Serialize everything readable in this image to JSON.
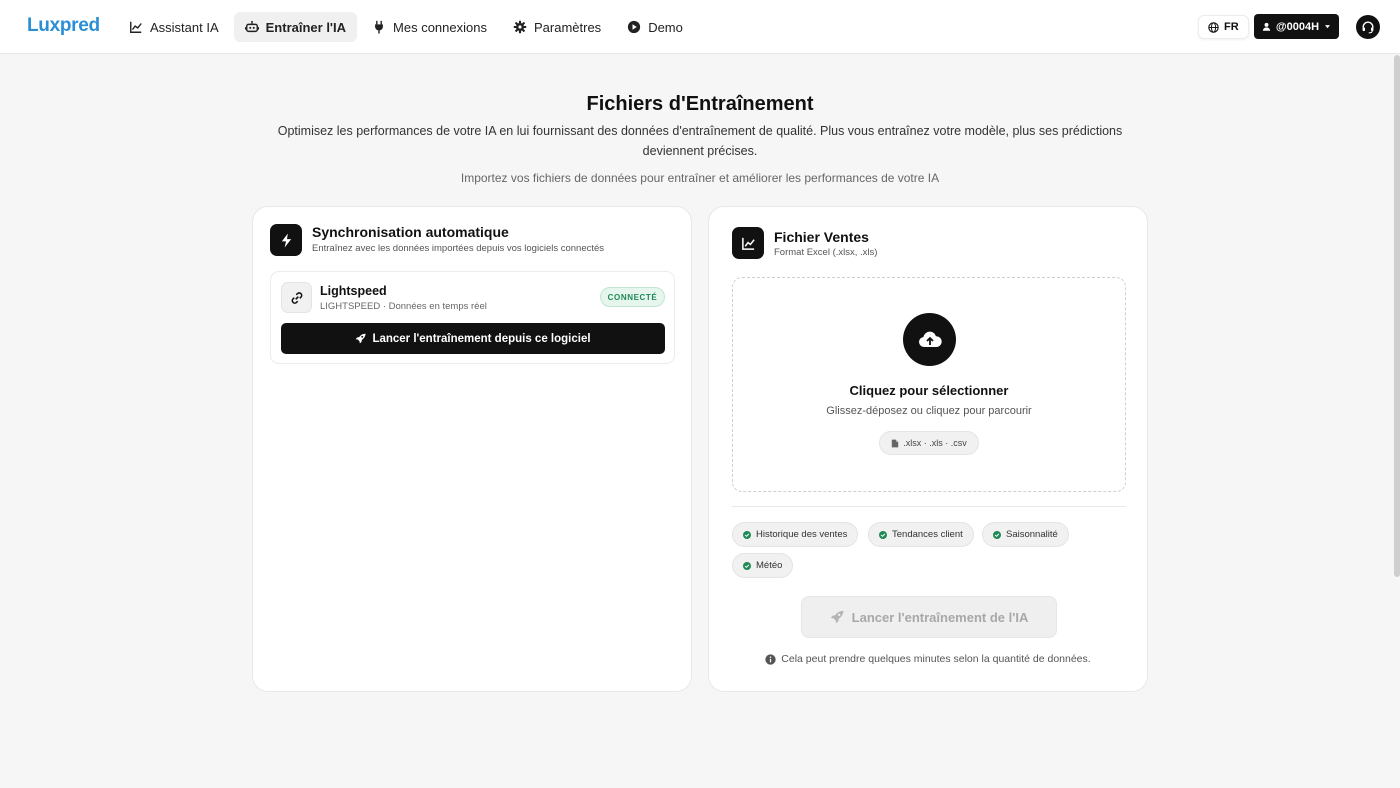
{
  "nav": {
    "logo": "Luxpred",
    "links": [
      {
        "label": "Assistant IA",
        "icon": "chart-line-icon",
        "active": false
      },
      {
        "label": "Entraîner l'IA",
        "icon": "robot-icon",
        "active": true
      },
      {
        "label": "Mes connexions",
        "icon": "plug-icon",
        "active": false
      },
      {
        "label": "Paramètres",
        "icon": "gear-icon",
        "active": false
      },
      {
        "label": "Demo",
        "icon": "play-circle-icon",
        "active": false
      }
    ],
    "lang": "FR",
    "user": "@0004H"
  },
  "header": {
    "title": "Fichiers d'Entraînement",
    "description": "Optimisez les performances de votre IA en lui fournissant des données d'entraînement de qualité. Plus vous entraînez votre modèle, plus ses prédictions deviennent précises.",
    "subtitle": "Importez vos fichiers de données pour entraîner et améliorer les performances de votre IA"
  },
  "sync_card": {
    "title": "Synchronisation automatique",
    "subtitle": "Entraînez avec les données importées depuis vos logiciels connectés",
    "integration": {
      "name": "Lightspeed",
      "meta": "LIGHTSPEED · Données en temps réel",
      "badge": "CONNECTÉ",
      "button": "Lancer l'entraînement depuis ce logiciel"
    }
  },
  "file_card": {
    "title": "Fichier Ventes",
    "subtitle": "Format Excel (.xlsx, .xls)",
    "dropzone": {
      "title": "Cliquez pour sélectionner",
      "subtitle": "Glissez-déposez ou cliquez pour parcourir",
      "formats": ".xlsx · .xls · .csv"
    },
    "tags": [
      "Historique des ventes",
      "Tendances client",
      "Saisonnalité",
      "Météo"
    ],
    "launch_button": "Lancer l'entraînement de l'IA",
    "info": "Cela peut prendre quelques minutes selon la quantité de données."
  },
  "colors": {
    "brand": "#2b8fd6",
    "dark": "#111111",
    "success": "#1f8a55"
  }
}
